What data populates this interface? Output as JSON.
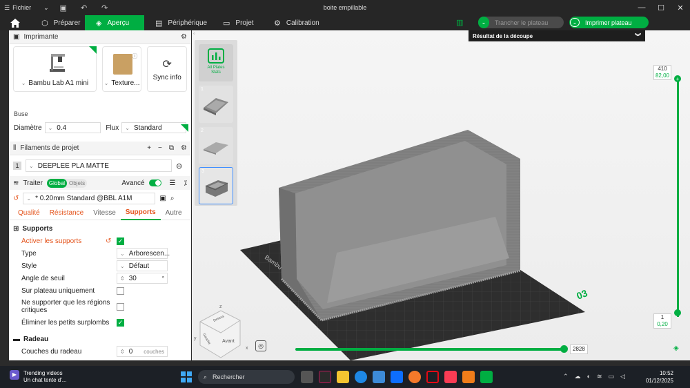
{
  "titlebar": {
    "file_label": "Fichier",
    "window_title": "boite empillable"
  },
  "nav": {
    "tabs": [
      {
        "label": "Préparer"
      },
      {
        "label": "Aperçu"
      },
      {
        "label": "Périphérique"
      },
      {
        "label": "Projet"
      },
      {
        "label": "Calibration"
      }
    ],
    "active_tab": "Aperçu",
    "slice_label": "Trancher le plateau",
    "print_label": "Imprimer plateau"
  },
  "printer": {
    "header": "Imprimante",
    "model": "Bambu Lab A1 mini",
    "plate": "Texture...",
    "sync_label": "Sync info",
    "nozzle_title": "Buse",
    "diameter_label": "Diamètre",
    "diameter_value": "0.4",
    "flow_label": "Flux",
    "flow_value": "Standard"
  },
  "filaments": {
    "header": "Filaments de projet",
    "items": [
      {
        "index": "1",
        "name": "DEEPLEE PLA MATTE"
      }
    ]
  },
  "process": {
    "header": "Traiter",
    "seg_global": "Global",
    "seg_objects": "Objets",
    "advanced_label": "Avancé",
    "preset": "* 0.20mm Standard @BBL A1M",
    "tabs": [
      "Qualité",
      "Résistance",
      "Vitesse",
      "Supports",
      "Autre"
    ],
    "active_tab": "Supports",
    "groups": [
      {
        "title": "Supports",
        "options": [
          {
            "label": "Activer les supports",
            "type": "check",
            "checked": true,
            "modified": true
          },
          {
            "label": "Type",
            "type": "select",
            "value": "Arborescen..."
          },
          {
            "label": "Style",
            "type": "select",
            "value": "Défaut"
          },
          {
            "label": "Angle de seuil",
            "type": "spin",
            "value": "30",
            "unit": "°"
          },
          {
            "label": "Sur plateau uniquement",
            "type": "check",
            "checked": false
          },
          {
            "label": "Ne supporter que les régions critiques",
            "type": "check",
            "checked": false
          },
          {
            "label": "Éliminer les petits surplombs",
            "type": "check",
            "checked": true
          }
        ]
      },
      {
        "title": "Radeau",
        "options": [
          {
            "label": "Couches du radeau",
            "type": "spin",
            "value": "0",
            "unit": "couches"
          }
        ]
      }
    ]
  },
  "viewport": {
    "result_bar": "Résultat de la découpe",
    "all_plates_label_1": "All Plates",
    "all_plates_label_2": "Stats",
    "plates": [
      "1",
      "2",
      "3"
    ],
    "active_plate": "3",
    "layer_top_1": "410",
    "layer_top_2": "82,00",
    "layer_bottom_1": "1",
    "layer_bottom_2": "0,20",
    "h_slider_value": "2828",
    "plate_number": "03",
    "bed_brand": "Bambu Te",
    "cube_faces": [
      "Avant",
      "Gauche",
      "Dessus"
    ],
    "axes": [
      "x",
      "y",
      "z"
    ],
    "accent": "#00ae42"
  },
  "taskbar": {
    "trend_title": "Trending videos",
    "trend_sub": "Un chat tente d'...",
    "search_label": "Rechercher",
    "time": "10:52",
    "date": "01/12/2025"
  }
}
